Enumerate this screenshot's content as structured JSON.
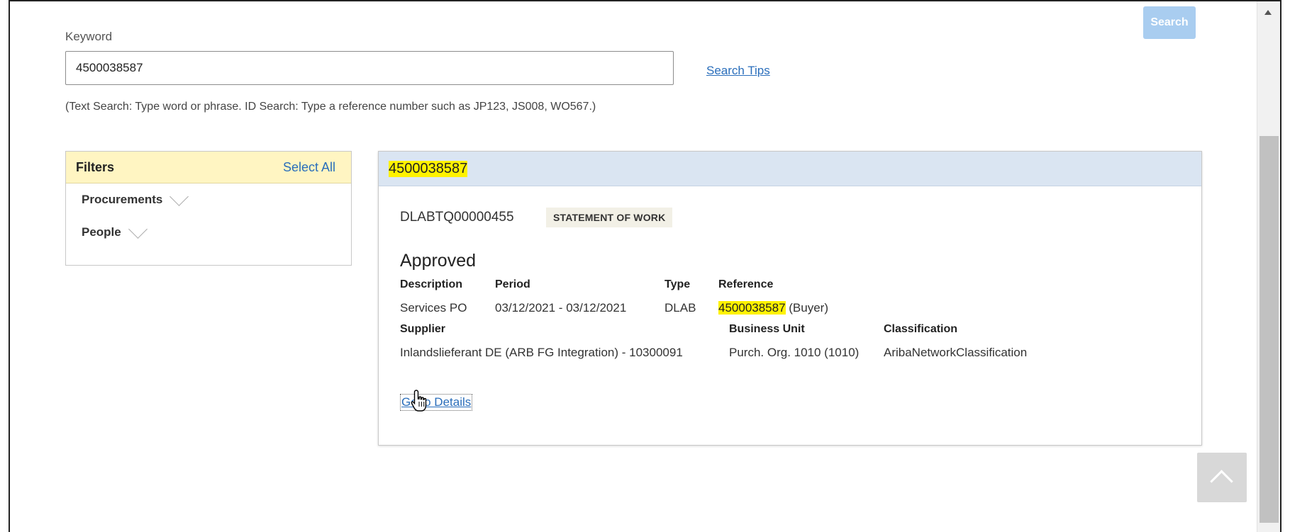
{
  "toolbar": {
    "search_label": "Search"
  },
  "search": {
    "keyword_label": "Keyword",
    "keyword_value": "4500038587",
    "search_tips": "Search Tips",
    "hint": "(Text Search: Type word or phrase. ID Search: Type a reference number such as JP123, JS008, WO567.)"
  },
  "filters": {
    "title": "Filters",
    "select_all": "Select All",
    "items": [
      {
        "label": "Procurements"
      },
      {
        "label": "People"
      }
    ]
  },
  "result": {
    "header_id": "4500038587",
    "doc_number": "DLABTQ00000455",
    "doc_type": "STATEMENT OF WORK",
    "status": "Approved",
    "description_label": "Description",
    "description_value": "Services PO",
    "period_label": "Period",
    "period_value": "03/12/2021 - 03/12/2021",
    "type_label": "Type",
    "type_value": "DLAB",
    "reference_label": "Reference",
    "reference_value": "4500038587",
    "reference_suffix": " (Buyer)",
    "supplier_label": "Supplier",
    "supplier_value": "Inlandslieferant DE (ARB FG Integration) - 10300091",
    "business_unit_label": "Business Unit",
    "business_unit_value": "Purch. Org. 1010 (1010)",
    "classification_label": "Classification",
    "classification_value": "AribaNetworkClassification",
    "details_link": "Go to Details"
  },
  "colors": {
    "accent": "#2a6ebb",
    "highlight": "#fff200",
    "search_button": "#a9cdf0",
    "filters_header": "#fff5c2",
    "card_header": "#dae5f2"
  },
  "icons": [
    "chevron-down-icon",
    "hand-cursor-icon",
    "back-to-top-icon",
    "scroll-up-icon"
  ]
}
